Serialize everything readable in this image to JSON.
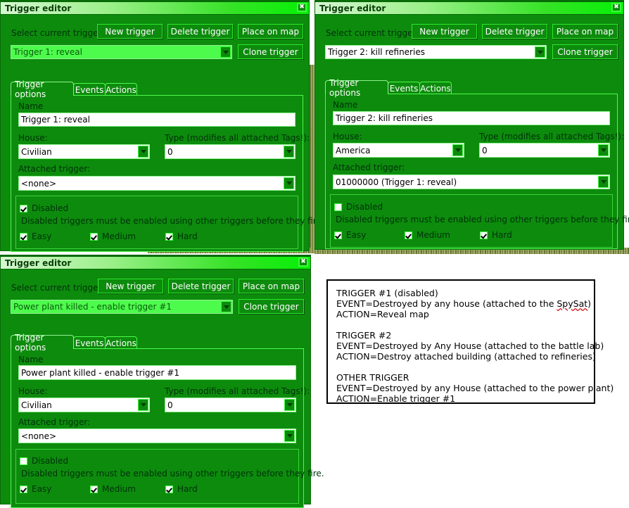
{
  "window_title": "Trigger editor",
  "close_glyph": "✖",
  "common": {
    "select_label": "Select current trigger:",
    "btn_new": "New trigger",
    "btn_delete": "Delete trigger",
    "btn_place": "Place on map",
    "btn_clone": "Clone trigger",
    "tab_options": "Trigger options",
    "tab_events": "Events",
    "tab_actions": "Actions",
    "name_label": "Name",
    "house_label": "House:",
    "type_label": "Type (modifies all attached Tags!):",
    "attached_label": "Attached trigger:",
    "disabled_label": "Disabled",
    "disabled_hint": "Disabled triggers must be enabled using other triggers before they fire.",
    "easy_label": "Easy",
    "medium_label": "Medium",
    "hard_label": "Hard"
  },
  "windows": [
    {
      "id": "window-1",
      "selected_trigger": "Trigger 1: reveal",
      "selected_trigger_focused": false,
      "name_value": "Trigger 1: reveal",
      "house_value": "Civilian",
      "type_value": "0",
      "attached_value": "<none>",
      "disabled_checked": true,
      "easy_checked": true,
      "medium_checked": true,
      "hard_checked": true
    },
    {
      "id": "window-2",
      "selected_trigger": "Trigger 2: kill refineries",
      "selected_trigger_focused": true,
      "name_value": "Trigger 2: kill refineries",
      "house_value": "America",
      "type_value": "0",
      "attached_value": "01000000 (Trigger 1: reveal)",
      "disabled_checked": false,
      "easy_checked": true,
      "medium_checked": true,
      "hard_checked": true
    },
    {
      "id": "window-3",
      "selected_trigger": "Power plant killed - enable trigger #1",
      "selected_trigger_focused": false,
      "name_value": "Power plant killed - enable trigger #1",
      "house_value": "Civilian",
      "type_value": "0",
      "attached_value": "<none>",
      "disabled_checked": false,
      "easy_checked": true,
      "medium_checked": true,
      "hard_checked": true
    }
  ],
  "notes": {
    "line1": "TRIGGER #1 (disabled)",
    "line2_a": "EVENT=Destroyed by any house (attached to the ",
    "line2_spell": "SpySat",
    "line2_b": ")",
    "line3": "ACTION=Reveal map",
    "line4": "",
    "line5": "TRIGGER #2",
    "line6": "EVENT=Destroyed by Any House (attached to the battle lab)",
    "line7": "ACTION=Destroy attached building (attached to refineries)",
    "line8": "",
    "line9": "OTHER TRIGGER",
    "line10": "EVENT=Destroyed by any House (attached to the power plant)",
    "line11": "ACTION=Enable trigger #1"
  },
  "colors": {
    "window_bg": "#0d8b0d",
    "title_accent": "#05f005",
    "text": "#00320a",
    "input_bg": "#ffffff",
    "combo_green": "#4dfb4d"
  }
}
